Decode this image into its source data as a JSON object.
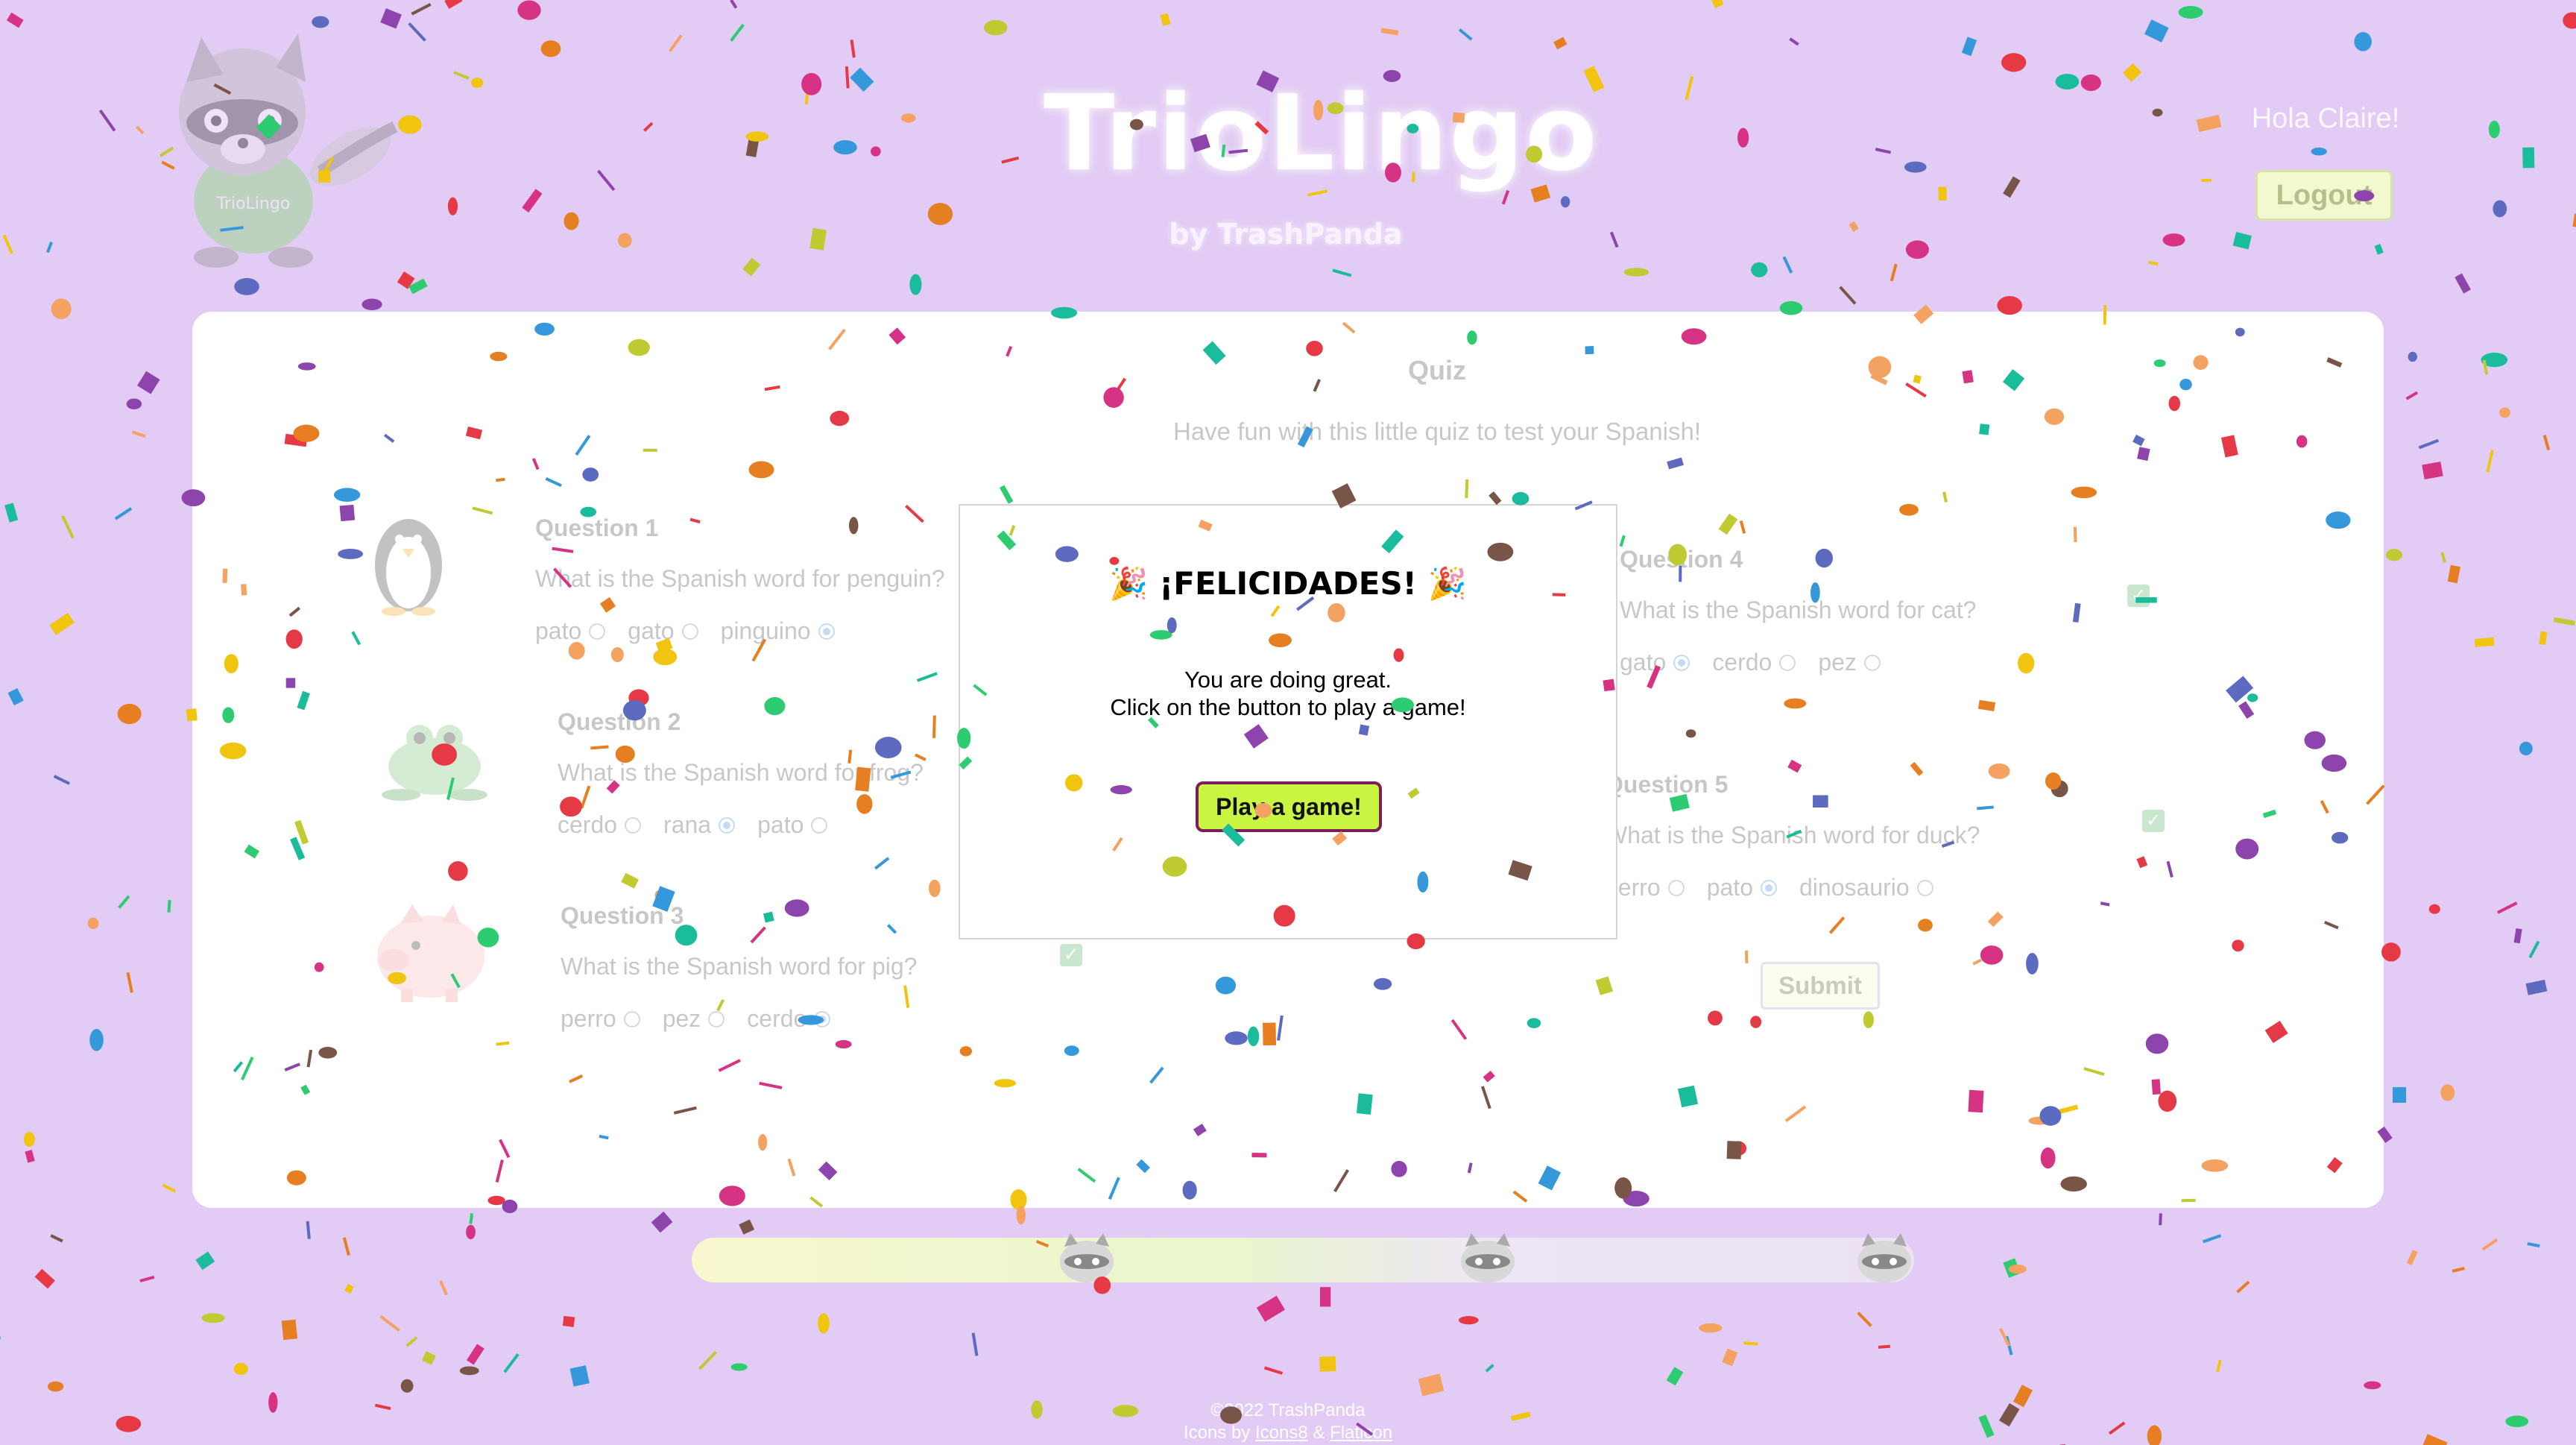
{
  "header": {
    "brand_title": "TrioLingo",
    "brand_subtitle": "by TrashPanda",
    "mascot_shirt_text": "TrioLingo",
    "greeting": "Hola Claire!",
    "logout_label": "Logout"
  },
  "quiz": {
    "title": "Quiz",
    "subtitle": "Have fun with this little quiz to test your Spanish!",
    "questions": [
      {
        "title": "Question 1",
        "text": "What is the Spanish word for penguin?",
        "animal_icon": "penguin-icon",
        "options": [
          "pato",
          "gato",
          "pinguino"
        ],
        "selected": "pinguino",
        "correct": false
      },
      {
        "title": "Question 2",
        "text": "What is the Spanish word for frog?",
        "animal_icon": "frog-icon",
        "options": [
          "cerdo",
          "rana",
          "pato"
        ],
        "selected": "rana",
        "correct": false
      },
      {
        "title": "Question 3",
        "text": "What is the Spanish word for pig?",
        "animal_icon": "pig-icon",
        "options": [
          "perro",
          "pez",
          "cerdo"
        ],
        "selected": "cerdo",
        "correct": true
      },
      {
        "title": "Question 4",
        "text": "What is the Spanish word for cat?",
        "options": [
          "gato",
          "cerdo",
          "pez"
        ],
        "selected": "gato",
        "correct": true
      },
      {
        "title": "Question 5",
        "text": "What is the Spanish word for duck?",
        "options": [
          "perro",
          "pato",
          "dinosaurio"
        ],
        "selected": "pato",
        "correct": true
      }
    ],
    "submit_label": "Submit"
  },
  "modal": {
    "title": "¡FELICIDADES!",
    "emoji": "🎉",
    "line1": "You are doing great.",
    "line2": "Click on the button to play a game!",
    "button_label": "Play a game!"
  },
  "progress": {
    "fraction": 1.0,
    "milestone_icons": [
      "raccoon-icon",
      "raccoon-icon",
      "raccoon-icon"
    ]
  },
  "footer": {
    "copyright": "©2022 TrashPanda",
    "icons_prefix": "Icons by ",
    "icons8": "Icons8",
    "amp": " & ",
    "flaticon": "Flaticon"
  },
  "colors": {
    "background": "#e2cbf4",
    "panel": "#ffffff",
    "button_green": "#c9f542",
    "button_border": "#7a1f5a",
    "light_green": "#f2f9cf"
  }
}
